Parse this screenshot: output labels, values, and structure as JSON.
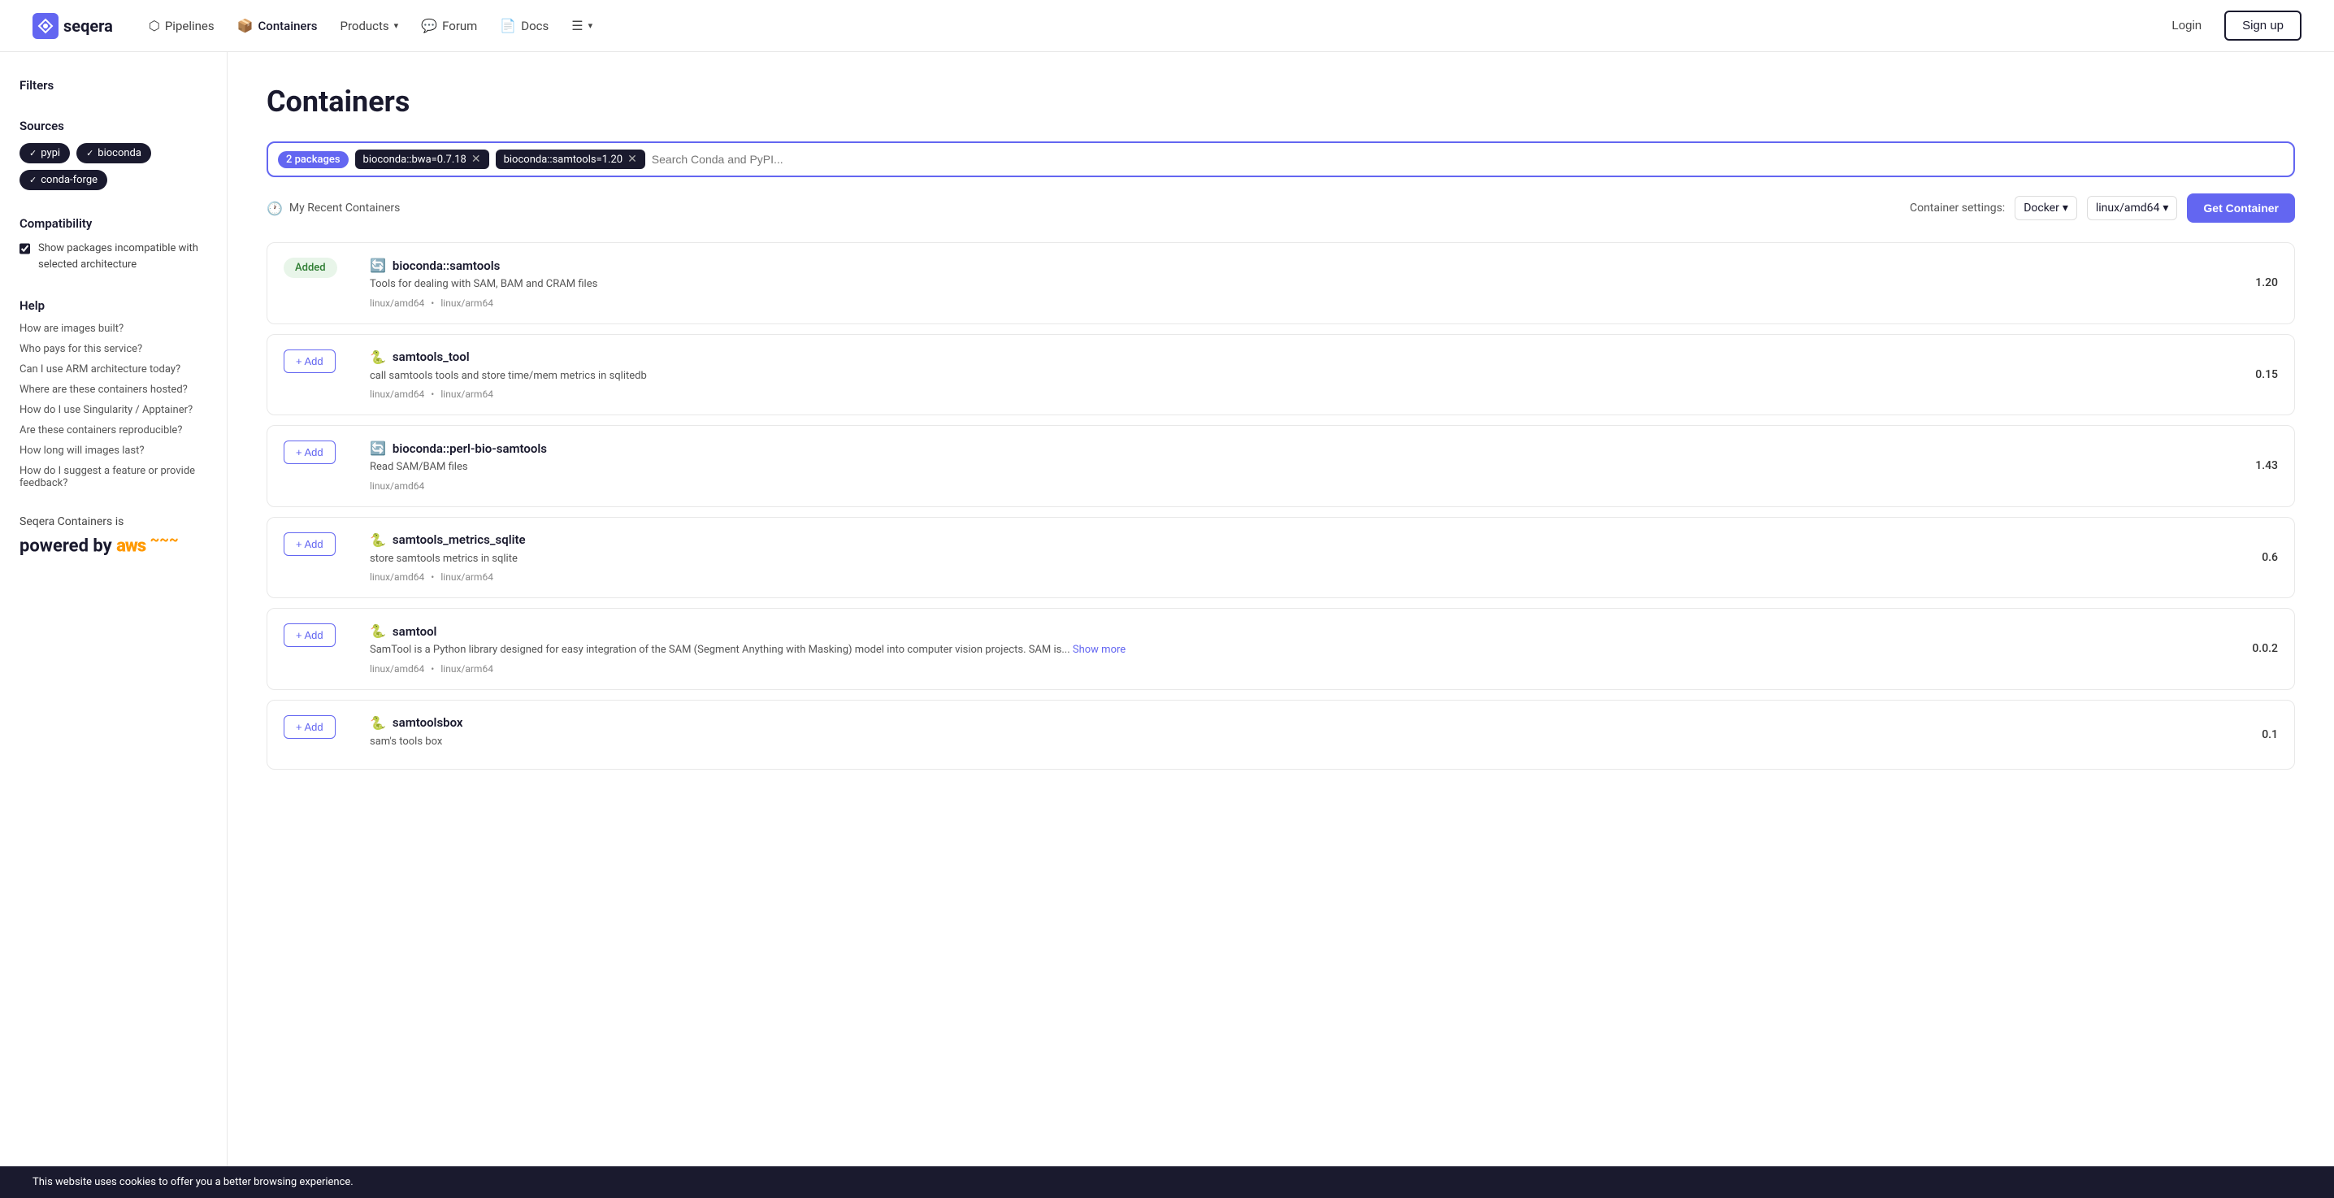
{
  "nav": {
    "logo_text": "seqera",
    "links": [
      {
        "id": "pipelines",
        "label": "Pipelines",
        "icon": "⬡"
      },
      {
        "id": "containers",
        "label": "Containers",
        "icon": "📦"
      },
      {
        "id": "products",
        "label": "Products",
        "icon": "",
        "has_dropdown": true
      },
      {
        "id": "forum",
        "label": "Forum",
        "icon": "💬"
      },
      {
        "id": "docs",
        "label": "Docs",
        "icon": "📄"
      },
      {
        "id": "more",
        "label": "",
        "icon": "☰",
        "has_dropdown": true
      }
    ],
    "login_label": "Login",
    "signup_label": "Sign up"
  },
  "sidebar": {
    "filters_title": "Filters",
    "sources_title": "Sources",
    "sources": [
      {
        "id": "pypi",
        "label": "pypi",
        "active": true
      },
      {
        "id": "bioconda",
        "label": "bioconda",
        "active": true
      },
      {
        "id": "conda-forge",
        "label": "conda-forge",
        "active": true
      }
    ],
    "compatibility_title": "Compatibility",
    "compatibility_checkbox_label": "Show packages incompatible with selected architecture",
    "compatibility_checked": true,
    "help_title": "Help",
    "help_links": [
      "How are images built?",
      "Who pays for this service?",
      "Can I use ARM architecture today?",
      "Where are these containers hosted?",
      "How do I use Singularity / Apptainer?",
      "Are these containers reproducible?",
      "How long will images last?",
      "How do I suggest a feature or provide feedback?"
    ],
    "powered_text": "Seqera Containers is",
    "powered_by": "powered by",
    "aws_label": "aws"
  },
  "main": {
    "page_title": "Containers",
    "search": {
      "pkg_count": "2 packages",
      "filters": [
        {
          "id": "bwa",
          "label": "bioconda::bwa=0.7.18"
        },
        {
          "id": "samtools",
          "label": "bioconda::samtools=1.20"
        }
      ],
      "placeholder": "Search Conda and PyPI..."
    },
    "recent_containers_label": "My Recent Containers",
    "settings_label": "Container settings:",
    "docker_label": "Docker",
    "arch_label": "linux/amd64",
    "get_container_label": "Get Container",
    "packages": [
      {
        "id": "bioconda-samtools",
        "status": "added",
        "status_label": "Added",
        "icon_type": "bioconda",
        "name": "bioconda::samtools",
        "description": "Tools for dealing with SAM, BAM and CRAM files",
        "platforms": [
          "linux/amd64",
          "linux/arm64"
        ],
        "version": "1.20"
      },
      {
        "id": "samtools-tool",
        "status": "add",
        "status_label": "+ Add",
        "icon_type": "pypi",
        "name": "samtools_tool",
        "description": "call samtools tools and store time/mem metrics in sqlitedb",
        "platforms": [
          "linux/amd64",
          "linux/arm64"
        ],
        "version": "0.15"
      },
      {
        "id": "perl-bio-samtools",
        "status": "add",
        "status_label": "+ Add",
        "icon_type": "bioconda",
        "name": "bioconda::perl-bio-samtools",
        "description": "Read SAM/BAM files",
        "platforms": [
          "linux/amd64"
        ],
        "version": "1.43"
      },
      {
        "id": "samtools-metrics-sqlite",
        "status": "add",
        "status_label": "+ Add",
        "icon_type": "pypi",
        "name": "samtools_metrics_sqlite",
        "description": "store samtools metrics in sqlite",
        "platforms": [
          "linux/amd64",
          "linux/arm64"
        ],
        "version": "0.6"
      },
      {
        "id": "samtool",
        "status": "add",
        "status_label": "+ Add",
        "icon_type": "pypi",
        "name": "samtool",
        "description": "SamTool is a Python library designed for easy integration of the SAM (Segment Anything with Masking) model into computer vision projects. SAM is...",
        "show_more": true,
        "platforms": [
          "linux/amd64",
          "linux/arm64"
        ],
        "version": "0.0.2"
      },
      {
        "id": "samtoolsbox",
        "status": "add",
        "status_label": "+ Add",
        "icon_type": "pypi",
        "name": "samtoolsbox",
        "description": "sam's tools box",
        "platforms": [],
        "version": "0.1"
      }
    ],
    "cookie_text": "This website uses cookies to offer you a better browsing experience."
  }
}
